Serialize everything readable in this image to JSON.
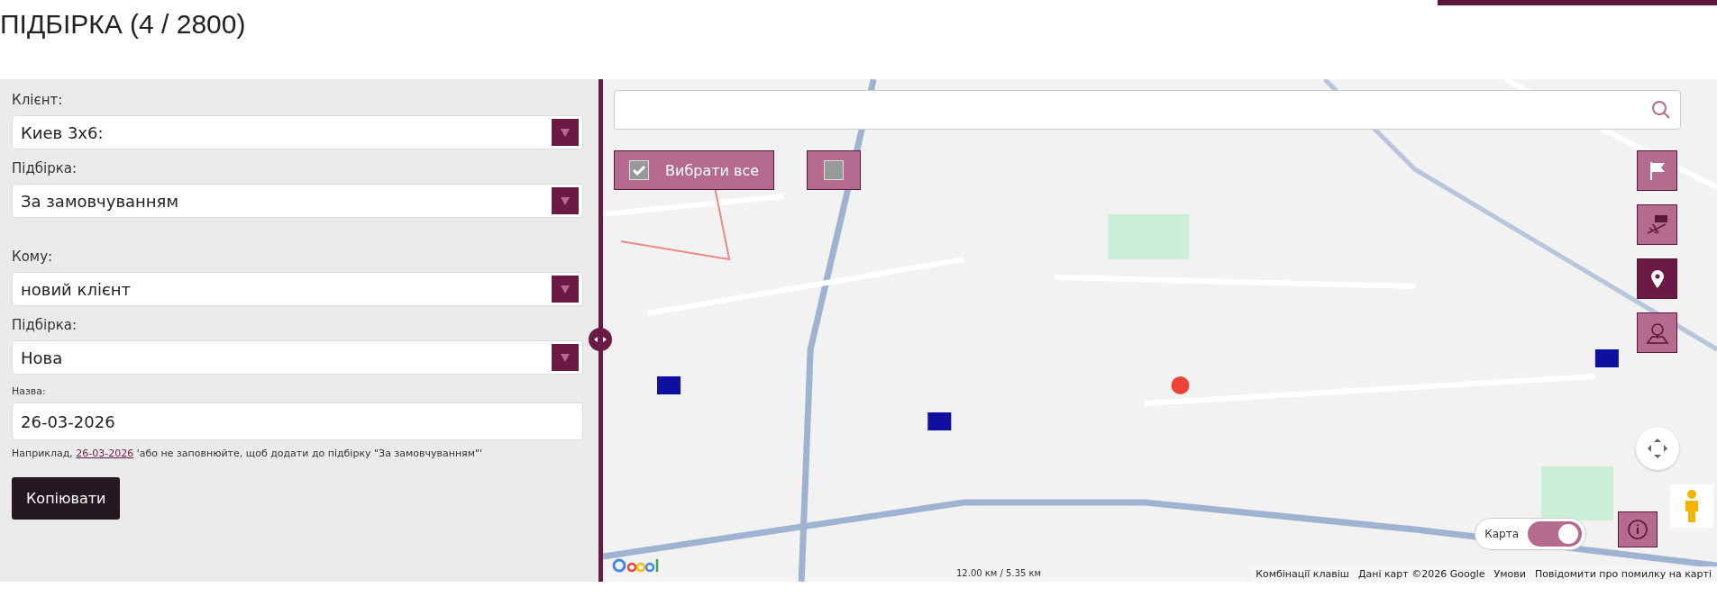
{
  "page_title": "ПІДБІРКА (4 / 2800)",
  "form": {
    "groups": [
      [
        {
          "kind": "select",
          "label": "Клієнт:",
          "value": "Киев 3х6:"
        },
        {
          "kind": "select",
          "label": "Підбірка:",
          "value": "За замовчуванням"
        }
      ],
      [
        {
          "kind": "select",
          "label": "Кому:",
          "value": "новий клієнт"
        },
        {
          "kind": "select",
          "label": "Підбірка:",
          "value": "Нова"
        },
        {
          "kind": "input",
          "label": "Назва:",
          "value": "26-03-2026"
        }
      ]
    ],
    "hint": {
      "before": "Наприклад,",
      "link": "26-03-2026",
      "after": "'або не заповнюйте, щоб додати до підбірку \"За замовчуванням\"'"
    },
    "copy_button": "Копіювати"
  },
  "map": {
    "select_all": {
      "label": "Вибрати все",
      "checked": true
    },
    "second_checkbox": {
      "checked": false
    },
    "tools": [
      {
        "selected": false
      },
      {
        "selected": false
      },
      {
        "selected": true
      },
      {
        "selected": false
      }
    ],
    "map_toggle": {
      "label": "Карта",
      "on": true
    },
    "scale": "12.00 км / 5.35 км",
    "footer": [
      "Комбінації клавіш",
      "Дані карт ©2026 Google",
      "Умови",
      "Повідомити про помилку на карті"
    ]
  }
}
